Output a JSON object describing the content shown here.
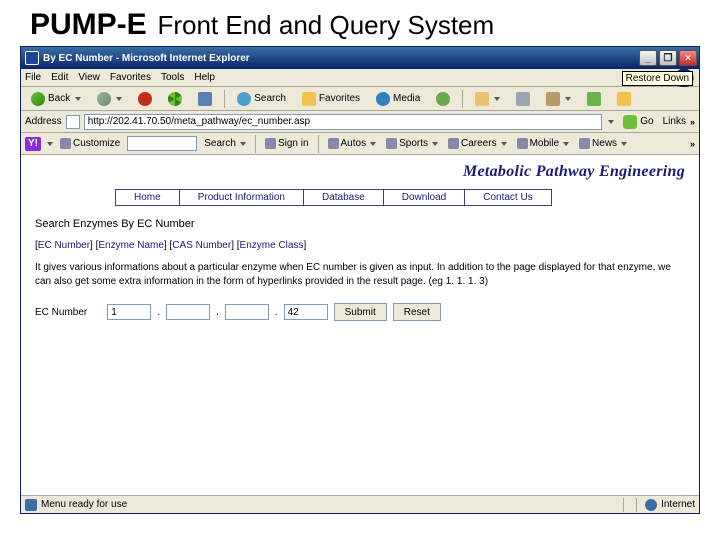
{
  "slide": {
    "title1": "PUMP-E",
    "title2": "Front End and Query System"
  },
  "window": {
    "title": "By EC Number - Microsoft Internet Explorer",
    "restore_tooltip": "Restore Down"
  },
  "menubar": {
    "file": "File",
    "edit": "Edit",
    "view": "View",
    "favorites": "Favorites",
    "tools": "Tools",
    "help": "Help"
  },
  "toolbar": {
    "back": "Back",
    "search": "Search",
    "favorites": "Favorites",
    "media": "Media"
  },
  "address": {
    "label": "Address",
    "url": "http://202.41.70.50/meta_pathway/ec_number.asp",
    "go": "Go",
    "links": "Links"
  },
  "yahoo": {
    "customize": "Customize",
    "search": "Search",
    "signin": "Sign in",
    "autos": "Autos",
    "sports": "Sports",
    "careers": "Careers",
    "mobile": "Mobile",
    "news": "News"
  },
  "page": {
    "brand": "Metabolic Pathway Engineering",
    "nav": {
      "home": "Home",
      "product": "Product Information",
      "database": "Database",
      "download": "Download",
      "contact": "Contact Us"
    },
    "section_heading": "Search Enzymes By EC Number",
    "links": {
      "ec": "EC Number",
      "enzyme": "Enzyme Name",
      "cas": "CAS Number",
      "class": "Enzyme Class"
    },
    "body": "It gives various informations about a particular enzyme when EC number is given as input. In addition to the page displayed for that enzyme, we can also get some extra information in the form of hyperlinks provided in the result page. (eg 1. 1. 1. 3)",
    "ec_label": "EC Number",
    "ec": {
      "a": "1",
      "b": "",
      "c": "",
      "d": "42"
    },
    "submit": "Submit",
    "reset": "Reset"
  },
  "status": {
    "left": "Menu ready for use",
    "zone": "Internet"
  }
}
